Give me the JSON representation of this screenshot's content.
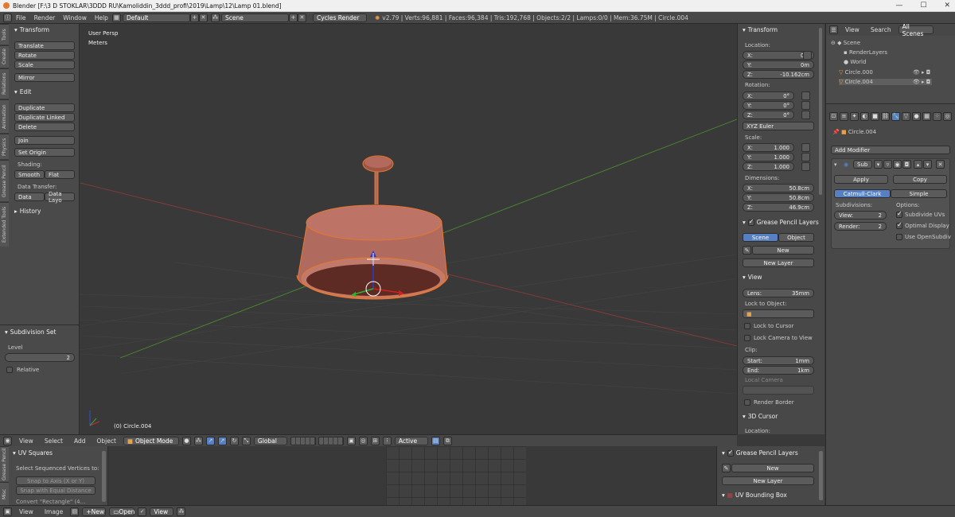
{
  "window": {
    "title": "Blender [F:\\3 D STOKLAR\\3DDD RU\\Kamoliddin_3ddd_profi\\2019\\Lamp\\12\\Lamp 01.blend]"
  },
  "infobar": {
    "menus": [
      "File",
      "Render",
      "Window",
      "Help"
    ],
    "layout": "Default",
    "scene": "Scene",
    "engine": "Cycles Render",
    "stats": "v2.79 | Verts:96,881 | Faces:96,384 | Tris:192,768 | Objects:2/2 | Lamps:0/0 | Mem:36.75M | Circle.004"
  },
  "toolshelf": {
    "tabs": [
      "Tools",
      "Create",
      "Relations",
      "Animation",
      "Physics",
      "Grease Pencil",
      "Extended Tools"
    ],
    "transform_header": "Transform",
    "translate": "Translate",
    "rotate": "Rotate",
    "scale": "Scale",
    "mirror": "Mirror",
    "edit_header": "Edit",
    "duplicate": "Duplicate",
    "duplicate_linked": "Duplicate Linked",
    "delete": "Delete",
    "join": "Join",
    "set_origin": "Set Origin",
    "shading_label": "Shading:",
    "smooth": "Smooth",
    "flat": "Flat",
    "data_transfer_label": "Data Transfer:",
    "data": "Data",
    "data_layo": "Data Layo",
    "history_header": "History",
    "subdiv_header": "Subdivision Set",
    "level_label": "Level",
    "level_value": "2",
    "relative": "Relative"
  },
  "viewport": {
    "view_label": "User Persp",
    "units": "Meters",
    "object_label": "(0) Circle.004"
  },
  "npanel": {
    "transform_header": "Transform",
    "location_label": "Location:",
    "loc": [
      {
        "a": "X:",
        "v": "0m"
      },
      {
        "a": "Y:",
        "v": "0m"
      },
      {
        "a": "Z:",
        "v": "-10.162cm"
      }
    ],
    "rotation_label": "Rotation:",
    "rot": [
      {
        "a": "X:",
        "v": "0°"
      },
      {
        "a": "Y:",
        "v": "0°"
      },
      {
        "a": "Z:",
        "v": "0°"
      }
    ],
    "rot_mode": "XYZ Euler",
    "scale_label": "Scale:",
    "scl": [
      {
        "a": "X:",
        "v": "1.000"
      },
      {
        "a": "Y:",
        "v": "1.000"
      },
      {
        "a": "Z:",
        "v": "1.000"
      }
    ],
    "dimensions_label": "Dimensions:",
    "dim": [
      {
        "a": "X:",
        "v": "50.8cm"
      },
      {
        "a": "Y:",
        "v": "50.8cm"
      },
      {
        "a": "Z:",
        "v": "46.9cm"
      }
    ],
    "gp_header": "Grease Pencil Layers",
    "gp_scene": "Scene",
    "gp_object": "Object",
    "gp_new": "New",
    "gp_new_layer": "New Layer",
    "view_header": "View",
    "lens_label": "Lens:",
    "lens_value": "35mm",
    "lock_object_label": "Lock to Object:",
    "lock_cursor": "Lock to Cursor",
    "lock_camera": "Lock Camera to View",
    "clip_label": "Clip:",
    "clip_start_label": "Start:",
    "clip_start": "1mm",
    "clip_end_label": "End:",
    "clip_end": "1km",
    "local_camera": "Local Camera",
    "render_border": "Render Border",
    "cursor_header": "3D Cursor",
    "cursor_location": "Location:"
  },
  "outliner": {
    "view": "View",
    "search": "Search",
    "filter": "All Scenes",
    "items": [
      "Scene",
      "RenderLayers",
      "World",
      "Circle.000",
      "Circle.004"
    ]
  },
  "properties": {
    "object": "Circle.004",
    "add_modifier": "Add Modifier",
    "mod_name": "Sub",
    "apply": "Apply",
    "copy": "Copy",
    "catmull": "Catmull-Clark",
    "simple": "Simple",
    "subdivisions_label": "Subdivisions:",
    "options_label": "Options:",
    "view_label": "View:",
    "view_value": "2",
    "render_label": "Render:",
    "render_value": "2",
    "subdivide_uvs": "Subdivide UVs",
    "optimal_display": "Optimal Display",
    "use_opensubdiv": "Use OpenSubdiv"
  },
  "viewheader": {
    "menus": [
      "View",
      "Select",
      "Add",
      "Object"
    ],
    "mode": "Object Mode",
    "orientation": "Global",
    "pivot": "Active"
  },
  "uv": {
    "tabs": [
      "Grease Pencil",
      "Misc"
    ],
    "header": "UV Squares",
    "select_seq": "Select Sequenced Vertices to:",
    "snap_axis": "Snap to Axis (X or Y)",
    "snap_equal": "Snap with Equal Distance",
    "convert": "Convert \"Rectangle\" (4...",
    "gp_header": "Grease Pencil Layers",
    "gp_new": "New",
    "gp_new_layer": "New Layer",
    "bbox_header": "UV Bounding Box"
  },
  "bottombar": {
    "menus": [
      "View",
      "Image"
    ],
    "new": "New",
    "open": "Open",
    "view": "View"
  },
  "colors": {
    "accent": "#5680c2",
    "mesh": "#b06a5e",
    "selection": "#e8772e",
    "x_axis": "#c04040",
    "y_axis": "#5a9e3a"
  }
}
